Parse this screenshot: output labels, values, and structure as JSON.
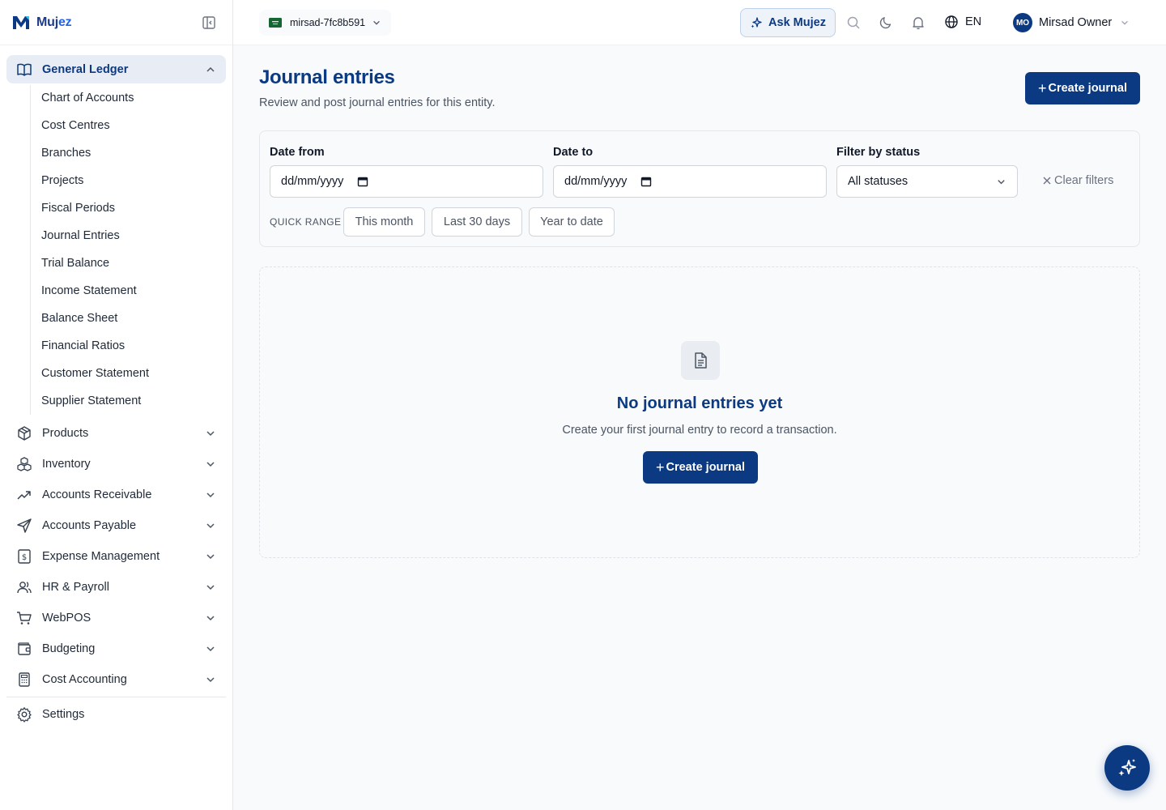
{
  "brand": {
    "name_main": "Muj",
    "name_accent": "ez"
  },
  "sidebar": {
    "general_ledger": {
      "label": "General Ledger",
      "items": [
        "Chart of Accounts",
        "Cost Centres",
        "Branches",
        "Projects",
        "Fiscal Periods",
        "Journal Entries",
        "Trial Balance",
        "Income Statement",
        "Balance Sheet",
        "Financial Ratios",
        "Customer Statement",
        "Supplier Statement"
      ]
    },
    "modules": [
      {
        "label": "Products",
        "icon": "package-icon"
      },
      {
        "label": "Inventory",
        "icon": "boxes-icon"
      },
      {
        "label": "Accounts Receivable",
        "icon": "trending-up-icon"
      },
      {
        "label": "Accounts Payable",
        "icon": "send-icon"
      },
      {
        "label": "Expense Management",
        "icon": "receipt-icon"
      },
      {
        "label": "HR & Payroll",
        "icon": "users-icon"
      },
      {
        "label": "WebPOS",
        "icon": "cart-icon"
      },
      {
        "label": "Budgeting",
        "icon": "wallet-icon"
      },
      {
        "label": "Cost Accounting",
        "icon": "calculator-icon"
      }
    ],
    "settings_label": "Settings"
  },
  "topbar": {
    "entity_name": "mirsad-7fc8b591",
    "ask_label": "Ask Mujez",
    "language": "EN",
    "user_initials": "MO",
    "user_name": "Mirsad Owner"
  },
  "page": {
    "title": "Journal entries",
    "subtitle": "Review and post journal entries for this entity.",
    "create_label": "Create journal"
  },
  "filters": {
    "date_from_label": "Date from",
    "date_from_value": "dd/mm/yyyy",
    "date_to_label": "Date to",
    "date_to_value": "dd/mm/yyyy",
    "status_label": "Filter by status",
    "status_value": "All statuses",
    "clear_label": "Clear filters",
    "quick_range_label": "QUICK RANGE",
    "quick_ranges": [
      "This month",
      "Last 30 days",
      "Year to date"
    ]
  },
  "empty_state": {
    "title": "No journal entries yet",
    "subtitle": "Create your first journal entry to record a transaction.",
    "create_label": "Create journal"
  },
  "colors": {
    "primary": "#0b3a82",
    "accent": "#2563eb",
    "active_bg": "#e8edf5"
  }
}
